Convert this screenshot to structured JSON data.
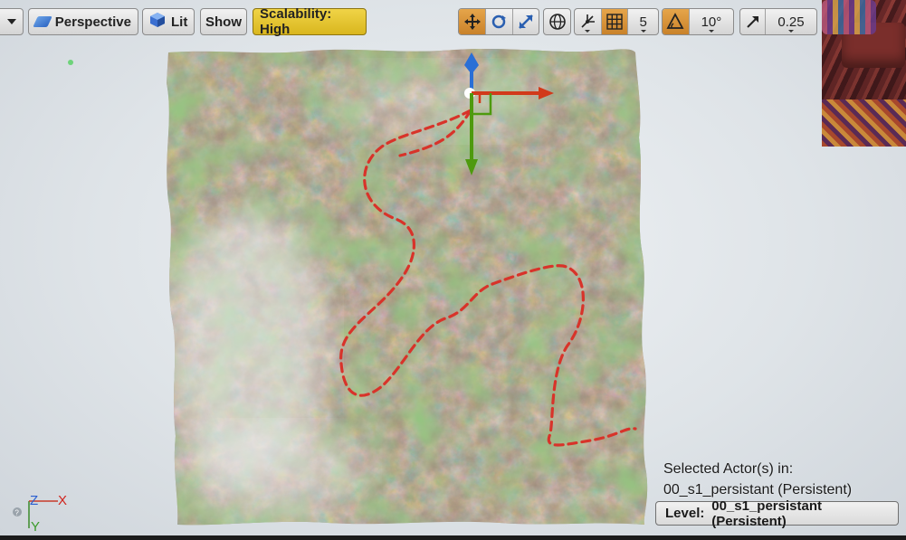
{
  "toolbar": {
    "perspective_label": "Perspective",
    "lit_label": "Lit",
    "show_label": "Show",
    "scalability_label": "Scalability: High",
    "grid_snap_value": "5",
    "rotation_snap_value": "10°",
    "scale_snap_value": "0.25"
  },
  "overlay": {
    "selected_line1": "Selected Actor(s) in:",
    "selected_line2": "00_s1_persistant (Persistent)",
    "level_label": "Level:",
    "level_value": "00_s1_persistant (Persistent)"
  },
  "axis": {
    "z": "Z",
    "x": "X",
    "y": "Y"
  },
  "colors": {
    "accent_orange": "#d58e34",
    "scalability_yellow": "#e3c12f",
    "spline_red": "#d8332a",
    "gizmo_x": "#d23a1a",
    "gizmo_y": "#4e9a0e",
    "gizmo_z": "#2a6fd6"
  },
  "icons": {
    "viewport_menu": "chevron-down-icon",
    "perspective": "perspective-icon",
    "lit": "lit-cube-icon",
    "translate": "translate-icon",
    "rotate": "rotate-icon",
    "scale": "scale-icon",
    "world_local": "globe-icon",
    "surface_snap": "surface-snap-icon",
    "grid_snap": "grid-icon",
    "rotation_snap": "angle-icon",
    "scale_snap": "scale-arrow-icon",
    "help": "question-icon"
  }
}
